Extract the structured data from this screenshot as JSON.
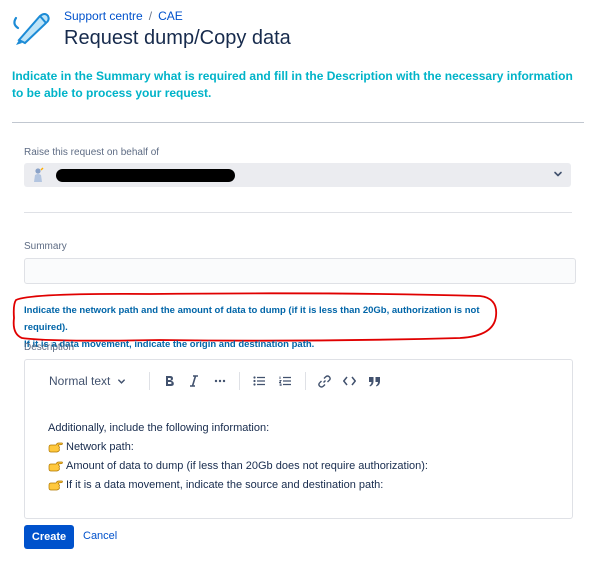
{
  "breadcrumb": {
    "parent": "Support centre",
    "separator": "/",
    "current": "CAE"
  },
  "page_title": "Request dump/Copy data",
  "intro_text": "Indicate in the Summary what is required and fill in the Description with the necessary information to be able to process your request.",
  "on_behalf": {
    "label": "Raise this request on behalf of"
  },
  "summary": {
    "label": "Summary",
    "value": ""
  },
  "hint": {
    "line1": "Indicate the network path and the amount of data to dump (if it is less than 20Gb, authorization is not required).",
    "line2": "If it is a data movement, indicate the origin and destination path."
  },
  "description": {
    "label": "Description",
    "toolbar": {
      "text_style": "Normal text"
    },
    "content": {
      "intro": "Additionally, include the following information:",
      "items": [
        "Network path:",
        "Amount of data to dump (if less than 20Gb does not require authorization):",
        "If it is a data movement, indicate the source and destination path:"
      ]
    }
  },
  "actions": {
    "create": "Create",
    "cancel": "Cancel"
  },
  "colors": {
    "accent": "#0052cc",
    "intro_text": "#00b3c8",
    "hint_text": "#0065a8",
    "annotation": "#e00000"
  }
}
